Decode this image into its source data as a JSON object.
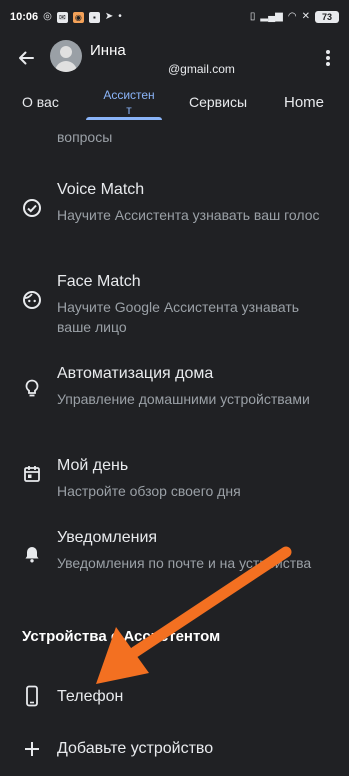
{
  "status_bar": {
    "time": "10:06",
    "battery": "73"
  },
  "header": {
    "account_name": "Инна",
    "account_email": "@gmail.com"
  },
  "tabs": [
    {
      "label": "О вас"
    },
    {
      "label_line1": "Ассистен",
      "label_line2": "т"
    },
    {
      "label": "Сервисы"
    },
    {
      "label": "Home"
    }
  ],
  "settings": {
    "partial_item_subtitle": "вопросы",
    "items": [
      {
        "title": "Voice Match",
        "subtitle": "Научите Ассистента узнавать ваш голос",
        "icon": "voice-match-icon"
      },
      {
        "title": "Face Match",
        "subtitle": "Научите Google Ассистента узнавать ваше лицо",
        "icon": "face-match-icon"
      },
      {
        "title": "Автоматизация дома",
        "subtitle": "Управление домашними устройствами",
        "icon": "lightbulb-icon"
      },
      {
        "title": "Мой день",
        "subtitle": "Настройте обзор своего дня",
        "icon": "calendar-icon"
      },
      {
        "title": "Уведомления",
        "subtitle": "Уведомления по почте и на устройства",
        "icon": "bell-icon"
      }
    ],
    "devices_section": {
      "heading": "Устройства с Ассистентом",
      "items": [
        {
          "title": "Телефон",
          "icon": "phone-icon"
        },
        {
          "title": "Добавьте устройство",
          "icon": "plus-icon"
        }
      ]
    }
  },
  "colors": {
    "background": "#202124",
    "accent": "#8ab4f8",
    "annotation_arrow": "#f37021"
  }
}
